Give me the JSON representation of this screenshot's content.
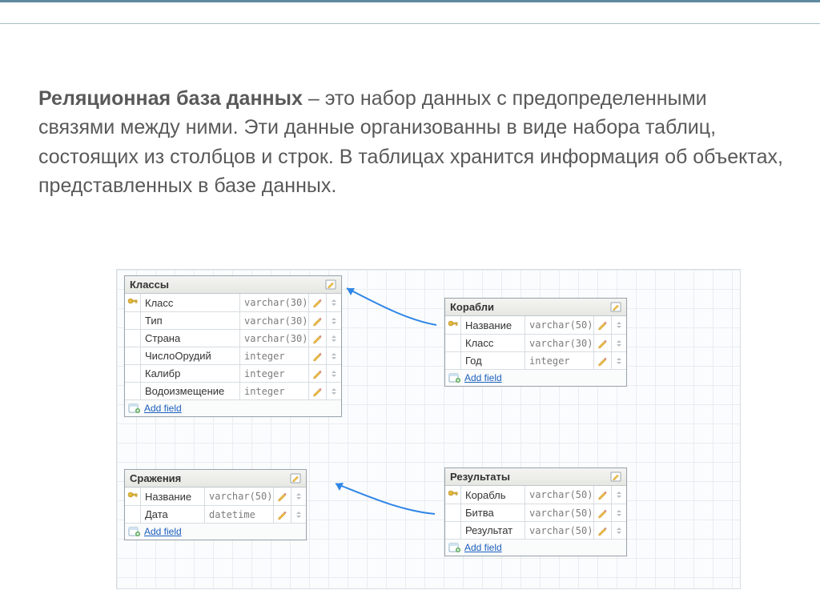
{
  "paragraph": {
    "term": "Реляционная база данных",
    "rest": " – это набор данных с предопределенными связями между ними. Эти данные организованны в виде набора таблиц, состоящих из столбцов и строк. В таблицах хранится информация об объектах, представленных в базе данных."
  },
  "add_field_label": "Add field",
  "tables": {
    "classes": {
      "title": "Классы",
      "fields": [
        {
          "key": true,
          "name": "Класс",
          "type": "varchar(30)"
        },
        {
          "key": false,
          "name": "Тип",
          "type": "varchar(30)"
        },
        {
          "key": false,
          "name": "Страна",
          "type": "varchar(30)"
        },
        {
          "key": false,
          "name": "ЧислоОрудий",
          "type": "integer"
        },
        {
          "key": false,
          "name": "Калибр",
          "type": "integer"
        },
        {
          "key": false,
          "name": "Водоизмещение",
          "type": "integer"
        }
      ]
    },
    "ships": {
      "title": "Корабли",
      "fields": [
        {
          "key": true,
          "name": "Название",
          "type": "varchar(50)"
        },
        {
          "key": false,
          "name": "Класс",
          "type": "varchar(30)"
        },
        {
          "key": false,
          "name": "Год",
          "type": "integer"
        }
      ]
    },
    "battles": {
      "title": "Сражения",
      "fields": [
        {
          "key": true,
          "name": "Название",
          "type": "varchar(50)"
        },
        {
          "key": false,
          "name": "Дата",
          "type": "datetime"
        }
      ]
    },
    "results": {
      "title": "Результаты",
      "fields": [
        {
          "key": true,
          "name": "Корабль",
          "type": "varchar(50)"
        },
        {
          "key": false,
          "name": "Битва",
          "type": "varchar(50)"
        },
        {
          "key": false,
          "name": "Результат",
          "type": "varchar(50)"
        }
      ]
    }
  }
}
